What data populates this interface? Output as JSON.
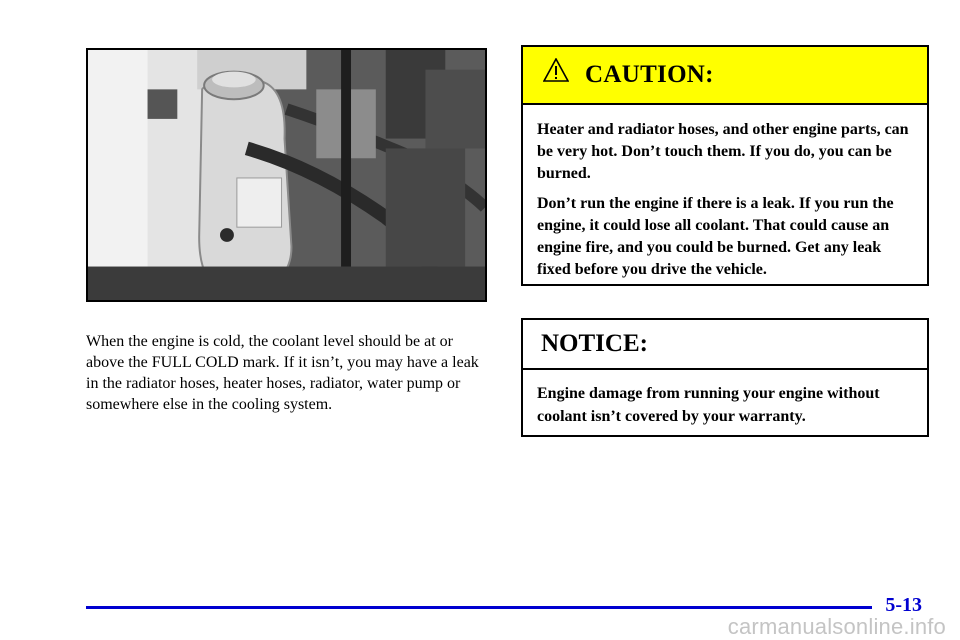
{
  "photo": {
    "description_icon": "engine-coolant-reservoir-photo"
  },
  "body_text": "When the engine is cold, the coolant level should be at or above the FULL COLD mark. If it isn’t, you may have a leak in the radiator hoses, heater hoses, radiator, water pump or somewhere else in the cooling system.",
  "caution": {
    "title": "CAUTION:",
    "icon": "warning-triangle-icon",
    "paragraphs": [
      "Heater and radiator hoses, and other engine parts, can be very hot. Don’t touch them. If you do, you can be burned.",
      "Don’t run the engine if there is a leak. If you run the engine, it could lose all coolant. That could cause an engine fire, and you could be burned. Get any leak fixed before you drive the vehicle."
    ],
    "header_color": "#ffff00"
  },
  "notice": {
    "title": "NOTICE:",
    "text": "Engine damage from running your engine without coolant isn’t covered by your warranty."
  },
  "footer": {
    "page_number": "5-13",
    "accent_color": "#0000d0"
  },
  "watermark": "carmanualsonline.info"
}
